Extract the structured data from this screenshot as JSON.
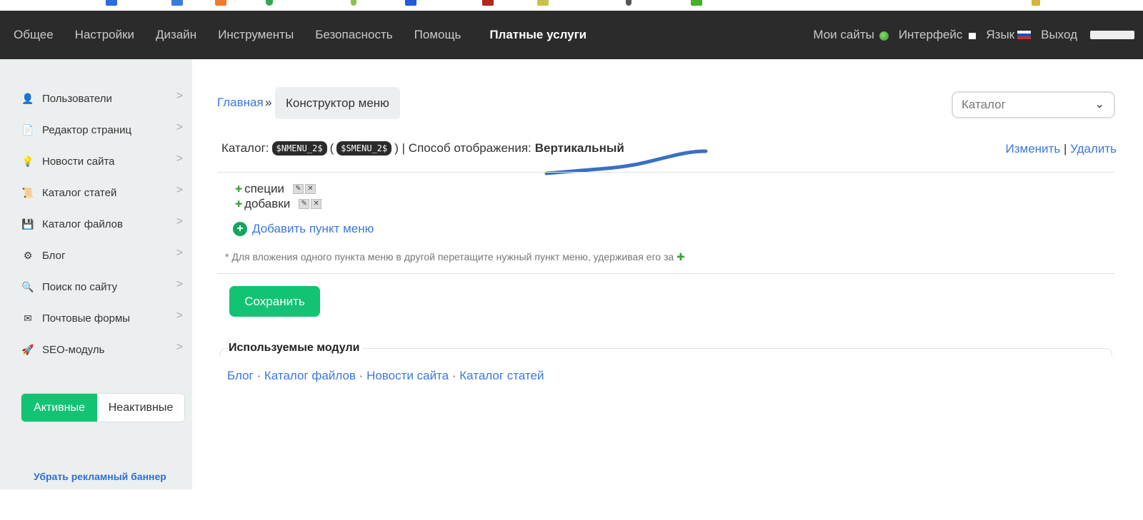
{
  "nav": {
    "items": [
      {
        "label": "Общее"
      },
      {
        "label": "Настройки"
      },
      {
        "label": "Дизайн"
      },
      {
        "label": "Инструменты"
      },
      {
        "label": "Безопасность"
      },
      {
        "label": "Помощь"
      }
    ],
    "paid_label": "Платные услуги",
    "my_sites": "Мои сайты",
    "interface": "Интерфейс",
    "language": "Язык",
    "logout": "Выход"
  },
  "sidebar": {
    "items": [
      {
        "label": "Пользователи",
        "icon": "user-icon"
      },
      {
        "label": "Редактор страниц",
        "icon": "page-icon"
      },
      {
        "label": "Новости сайта",
        "icon": "lightbulb-icon"
      },
      {
        "label": "Каталог статей",
        "icon": "scroll-icon"
      },
      {
        "label": "Каталог файлов",
        "icon": "floppy-icon"
      },
      {
        "label": "Блог",
        "icon": "gear-icon"
      },
      {
        "label": "Поиск по сайту",
        "icon": "magnifier-icon"
      },
      {
        "label": "Почтовые формы",
        "icon": "envelope-icon"
      },
      {
        "label": "SEO-модуль",
        "icon": "rocket-icon"
      }
    ],
    "toggle_active": "Активные",
    "toggle_inactive": "Неактивные",
    "promo": "Убрать рекламный баннер"
  },
  "breadcrumb": {
    "home": "Главная",
    "separator": "»",
    "current": "Конструктор меню"
  },
  "catalog_select": {
    "value": "Каталог"
  },
  "info": {
    "label": "Каталог:",
    "code1": "$NMENU_2$",
    "open_paren": "(",
    "code2": "$SMENU_2$",
    "close": ") | Способ отображения:",
    "display_mode": "Вертикальный",
    "edit": "Изменить",
    "divider": "|",
    "delete": "Удалить"
  },
  "menu_items": [
    {
      "label": "специи"
    },
    {
      "label": "добавки"
    }
  ],
  "add_menu_item": "Добавить пункт меню",
  "hint": "* Для вложения одного пункта меню в другой перетащите нужный пункт меню, удерживая его за",
  "save_label": "Сохранить",
  "modules": {
    "legend": "Используемые модули",
    "links": [
      {
        "label": "Блог"
      },
      {
        "label": "Каталог файлов"
      },
      {
        "label": "Новости сайта"
      },
      {
        "label": "Каталог статей"
      }
    ],
    "separator": "·"
  },
  "colors": {
    "accent_green": "#13c374",
    "link_blue": "#3a78e0",
    "nav_bg": "#2b2b2b",
    "sidebar_bg": "#eceff0",
    "annotation_stroke": "#3a6fc4"
  }
}
